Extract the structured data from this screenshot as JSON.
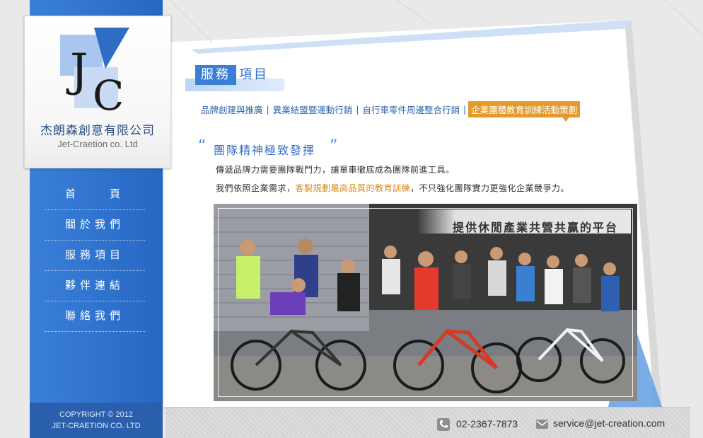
{
  "company": {
    "name_cn": "杰朗森創意有限公司",
    "name_en": "Jet-Craetion co. Ltd",
    "logo": "jc-logo"
  },
  "nav": {
    "items": [
      {
        "label": "首　　頁"
      },
      {
        "label": "關於我們"
      },
      {
        "label": "服務項目"
      },
      {
        "label": "夥伴連結"
      },
      {
        "label": "聯絡我們"
      }
    ]
  },
  "copyright": {
    "line1": "COPYRIGHT © 2012",
    "line2": "JET-CRAETION CO. LTD"
  },
  "section": {
    "title_highlight": "服務",
    "title_rest": "項目"
  },
  "tabs": [
    {
      "label": "品牌創建與推廣"
    },
    {
      "label": "異業結盟暨運動行銷"
    },
    {
      "label": "自行車零件周邊整合行銷"
    },
    {
      "label": "企業團體教育訓練活動策劃",
      "active": true
    }
  ],
  "tab_separator": "|",
  "article": {
    "quote_open": "“",
    "headline": "團隊精神極致發揮",
    "quote_close": "”",
    "para1": "傳遞品牌力需要團隊戰鬥力，讓單車徹底成為團隊前進工具。",
    "para2_before": "我們依照企業需求，",
    "para2_highlight": "客製規劃最高品質的教育訓練",
    "para2_after": "，不只強化團隊實力更強化企業競爭力。"
  },
  "photo": {
    "caption": "提供休閒產業共營共贏的平台"
  },
  "footer": {
    "phone": "02-2367-7873",
    "email": "service@jet-creation.com",
    "phone_icon": "phone-icon",
    "email_icon": "mail-icon"
  },
  "colors": {
    "brand_blue": "#2f73cf",
    "accent_orange": "#e39a2c",
    "title_blue": "#3b7ed6"
  }
}
